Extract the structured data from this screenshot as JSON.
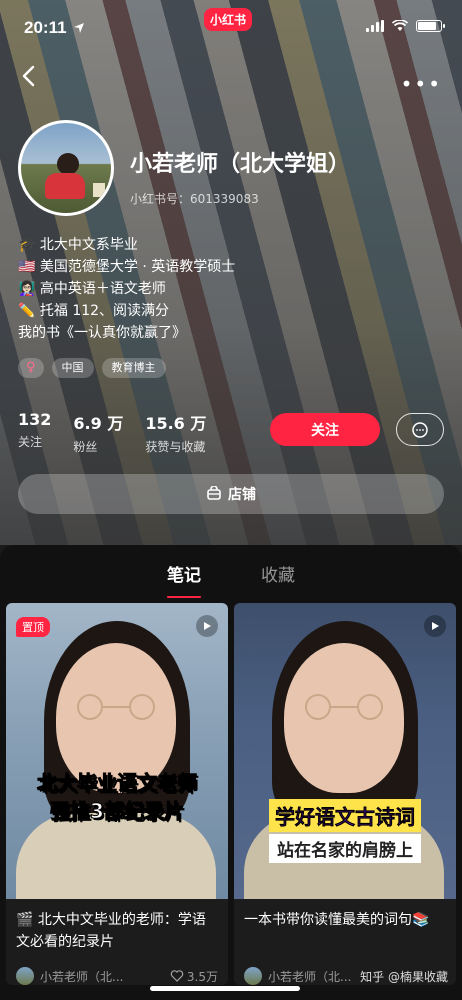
{
  "status_bar": {
    "time": "20:11",
    "app_badge": "小红书"
  },
  "profile": {
    "nickname": "小若老师（北大学姐）",
    "red_id": "小红书号：601339083",
    "bio": [
      "🎓 北大中文系毕业",
      "🇺🇸 美国范德堡大学 · 英语教学硕士",
      "👩🏻‍🏫 高中英语＋语文老师",
      "✏️ 托福 112、阅读满分",
      "我的书《一认真你就赢了》"
    ],
    "tags": [
      {
        "label": "♀",
        "kind": "gender"
      },
      {
        "label": "中国",
        "kind": "location"
      },
      {
        "label": "教育博主",
        "kind": "category"
      }
    ],
    "stats": [
      {
        "value": "132",
        "label": "关注"
      },
      {
        "value": "6.9 万",
        "label": "粉丝"
      },
      {
        "value": "15.6 万",
        "label": "获赞与收藏"
      }
    ],
    "follow_label": "关注",
    "shop_label": "店铺"
  },
  "tabs": [
    {
      "label": "笔记",
      "active": true
    },
    {
      "label": "收藏",
      "active": false
    }
  ],
  "notes": [
    {
      "pinned": true,
      "pin_label": "置顶",
      "overlay_line1": "北大毕业语文老师",
      "overlay_line2": "强推3部纪录片",
      "title": "🎬 北大中文毕业的老师：学语文必看的纪录片",
      "author": "小若老师（北...",
      "likes": "3.5万"
    },
    {
      "pinned": false,
      "overlay_line1": "学好语文古诗词",
      "overlay_line2": "站在名家的肩膀上",
      "title": "一本书带你读懂最美的词句📚",
      "author": "小若老师（北...",
      "likes": ""
    }
  ],
  "watermark": "知乎 @楠果收藏",
  "colors": {
    "accent": "#ff2442",
    "background": "#111111"
  }
}
